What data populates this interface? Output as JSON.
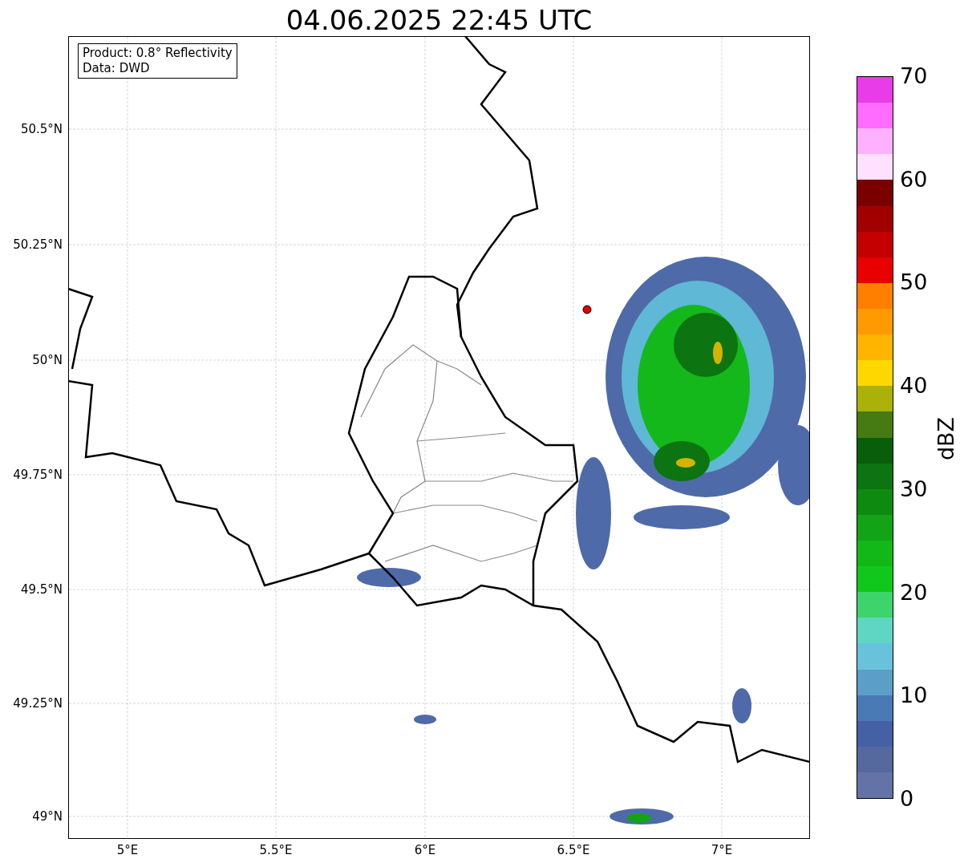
{
  "title": "04.06.2025 22:45 UTC",
  "info_box": [
    "Product: 0.8° Reflectivity",
    "Data: DWD"
  ],
  "y_ticks": [
    "50.5°N",
    "50.25°N",
    "50°N",
    "49.75°N",
    "49.5°N",
    "49.25°N",
    "49°N"
  ],
  "x_ticks": [
    "5°E",
    "5.5°E",
    "6°E",
    "6.5°E",
    "7°E"
  ],
  "colorbar": {
    "label": "dBZ",
    "ticks": [
      "70",
      "60",
      "50",
      "40",
      "30",
      "20",
      "10",
      "0"
    ],
    "bands": [
      {
        "color": "#e83ce8"
      },
      {
        "color": "#ff6cff"
      },
      {
        "color": "#ffb0ff"
      },
      {
        "color": "#ffe0ff"
      },
      {
        "color": "#7a0000"
      },
      {
        "color": "#a00000"
      },
      {
        "color": "#c40000"
      },
      {
        "color": "#e80000"
      },
      {
        "color": "#ff7f00"
      },
      {
        "color": "#ff9a00"
      },
      {
        "color": "#ffb400"
      },
      {
        "color": "#ffd700"
      },
      {
        "color": "#aab20a"
      },
      {
        "color": "#467a12"
      },
      {
        "color": "#085e0a"
      },
      {
        "color": "#0c7410"
      },
      {
        "color": "#0e8a10"
      },
      {
        "color": "#12a416"
      },
      {
        "color": "#12b818"
      },
      {
        "color": "#10c81c"
      },
      {
        "color": "#3ed46c"
      },
      {
        "color": "#5fd6c2"
      },
      {
        "color": "#68c2dc"
      },
      {
        "color": "#5b9ec8"
      },
      {
        "color": "#4a7ab5"
      },
      {
        "color": "#4560a4"
      },
      {
        "color": "#55699f"
      },
      {
        "color": "#6473a6"
      }
    ]
  }
}
